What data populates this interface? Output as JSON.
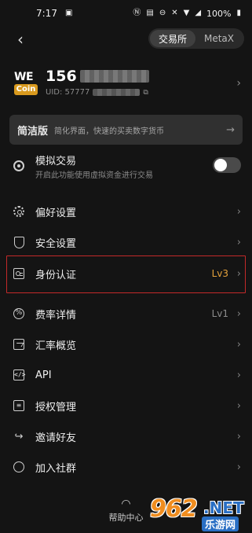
{
  "status_bar": {
    "time": "7:17",
    "battery": "100%"
  },
  "topbar": {
    "tabs": [
      {
        "label": "交易所",
        "active": true
      },
      {
        "label": "MetaX",
        "active": false
      }
    ]
  },
  "profile": {
    "logo_top": "WE",
    "logo_bottom": "Coin",
    "name_prefix": "156",
    "uid_prefix": "UID: 57777"
  },
  "lite_mode": {
    "title": "简洁版",
    "description": "简化界面，快速的买卖数字货币"
  },
  "demo_trading": {
    "title": "模拟交易",
    "description": "开启此功能使用虚拟资金进行交易",
    "enabled": false
  },
  "menu": [
    {
      "label": "偏好设置",
      "value": "",
      "icon": "gear-icon"
    },
    {
      "label": "安全设置",
      "value": "",
      "icon": "shield-icon"
    },
    {
      "label": "身份认证",
      "value": "Lv3",
      "icon": "id-card-icon"
    },
    {
      "label": "费率详情",
      "value": "Lv1",
      "icon": "percent-icon"
    },
    {
      "label": "汇率概览",
      "value": "",
      "icon": "chart-icon"
    },
    {
      "label": "API",
      "value": "",
      "icon": "code-icon"
    },
    {
      "label": "授权管理",
      "value": "",
      "icon": "authorization-icon"
    },
    {
      "label": "邀请好友",
      "value": "",
      "icon": "share-icon"
    },
    {
      "label": "加入社群",
      "value": "",
      "icon": "chat-icon"
    }
  ],
  "help": {
    "label": "帮助中心"
  },
  "watermark": {
    "brand_number": "962",
    "brand_domain": ".NET",
    "brand_cn": "乐游网"
  },
  "colors": {
    "background": "#141414",
    "accent": "#e6a23c",
    "highlight_border": "#c32a2a"
  }
}
